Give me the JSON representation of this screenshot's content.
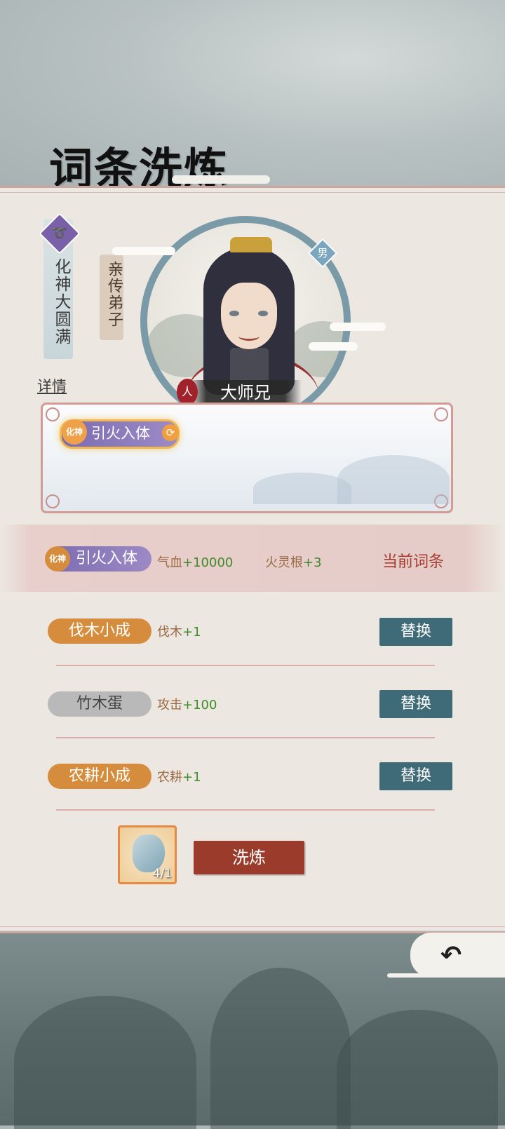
{
  "title": "词条洗炼",
  "character": {
    "realm": "化神大圆满",
    "realm_icon": "spiral-icon",
    "rank": "亲传弟子",
    "gender": "男",
    "race": "人",
    "name": "大师兄"
  },
  "details_link": "详情",
  "current_tag_box": {
    "realm_mini": "化神",
    "tag_name": "引火入体"
  },
  "current_entry": {
    "realm_mini": "化神",
    "tag_name": "引火入体",
    "stats": [
      {
        "label": "气血",
        "value": "+10000"
      },
      {
        "label": "火灵根",
        "value": "+3"
      }
    ],
    "status_label": "当前词条"
  },
  "options": [
    {
      "tag_name": "伐木小成",
      "color": "orange",
      "stat_label": "伐木",
      "stat_value": "+1",
      "button_label": "替换"
    },
    {
      "tag_name": "竹木蛋",
      "color": "grey",
      "stat_label": "攻击",
      "stat_value": "+100",
      "button_label": "替换"
    },
    {
      "tag_name": "农耕小成",
      "color": "orange",
      "stat_label": "农耕",
      "stat_value": "+1",
      "button_label": "替换"
    }
  ],
  "refine_item": {
    "count": "4/1",
    "icon": "spirit-stone-icon"
  },
  "refine_button": "洗炼",
  "back_icon": "return-arrow-icon",
  "colors": {
    "accent_red": "#9a3b2b",
    "replace_teal": "#3f6b78",
    "stat_green": "#3f8a2a",
    "purple_tag": "#7d6bb1",
    "orange_tag": "#d58d3d"
  }
}
